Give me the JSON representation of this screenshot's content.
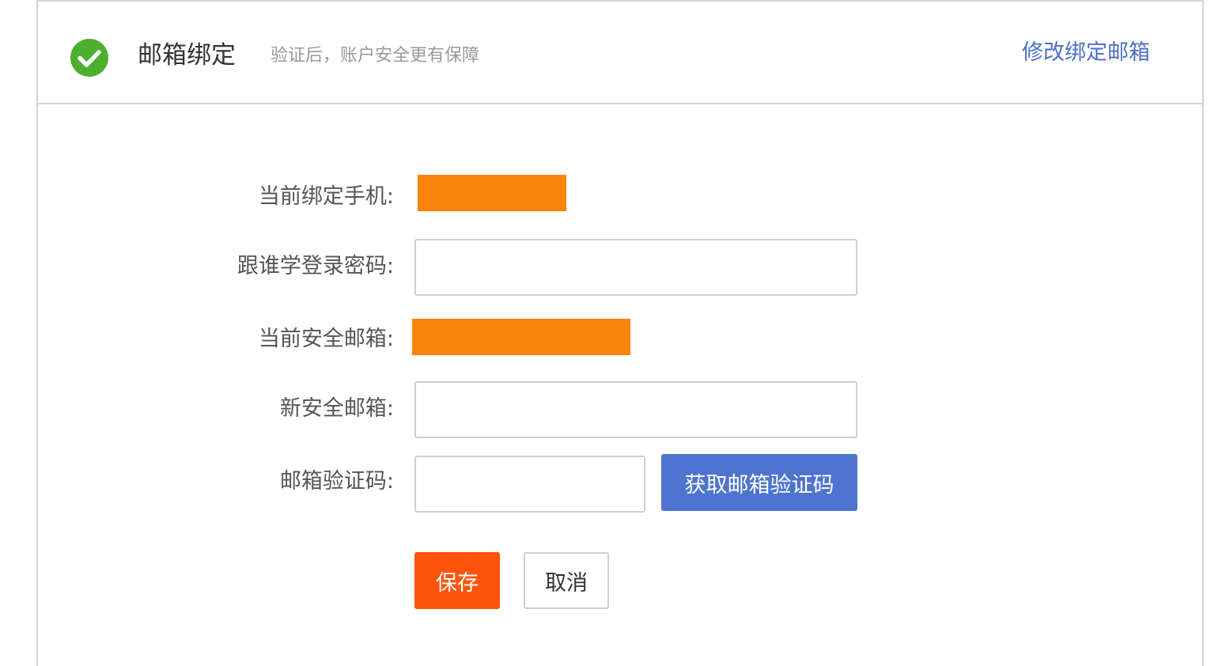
{
  "header": {
    "status_icon": "check-circle-icon",
    "title": "邮箱绑定",
    "subtitle": "验证后，账户安全更有保障",
    "modify_link": "修改绑定邮箱"
  },
  "form": {
    "current_phone_label": "当前绑定手机:",
    "password_label": "跟谁学登录密码:",
    "current_email_label": "当前安全邮箱:",
    "new_email_label": "新安全邮箱:",
    "email_code_label": "邮箱验证码:",
    "password_value": "",
    "new_email_value": "",
    "email_code_value": "",
    "get_code_button": "获取邮箱验证码",
    "save_button": "保存",
    "cancel_button": "取消"
  },
  "colors": {
    "success_green": "#4caf2e",
    "link_blue": "#4a6fc4",
    "redaction_orange": "#fb840c",
    "primary_blue": "#4f74cf",
    "save_orange": "#ff540b"
  }
}
